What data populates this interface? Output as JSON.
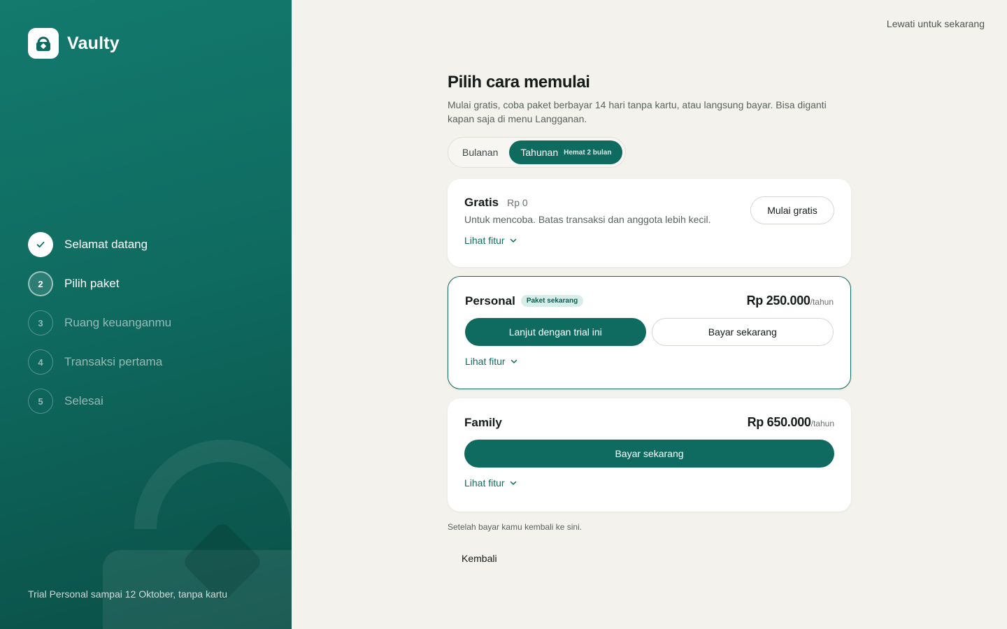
{
  "brand": {
    "name": "Vaulty",
    "icon": "lock-icon"
  },
  "steps": [
    {
      "number": "1",
      "label": "Selamat datang",
      "state": "done"
    },
    {
      "number": "2",
      "label": "Pilih paket",
      "state": "active"
    },
    {
      "number": "3",
      "label": "Ruang keuanganmu",
      "state": "todo"
    },
    {
      "number": "4",
      "label": "Transaksi pertama",
      "state": "todo"
    },
    {
      "number": "5",
      "label": "Selesai",
      "state": "todo"
    }
  ],
  "trial_note": "Trial Personal sampai 12 Oktober, tanpa kartu",
  "skip_label": "Lewati untuk sekarang",
  "heading": {
    "title": "Pilih cara memulai",
    "subtitle_line1": "Mulai gratis, coba paket berbayar 14 hari tanpa kartu, atau langsung bayar. Bisa diganti",
    "subtitle_line2": "kapan saja di menu Langganan."
  },
  "billing_toggle": {
    "monthly": "Bulanan",
    "yearly": "Tahunan",
    "yearly_tag": "Hemat 2 bulan",
    "selected": "yearly"
  },
  "plans": {
    "free": {
      "name": "Gratis",
      "price": "Rp 0",
      "description": "Untuk mencoba. Batas transaksi dan anggota lebih kecil.",
      "cta": "Mulai gratis",
      "features_label": "Lihat fitur"
    },
    "personal": {
      "name": "Personal",
      "badge": "Paket sekarang",
      "price": "Rp 250.000",
      "period": "/tahun",
      "cta_primary": "Lanjut dengan trial ini",
      "cta_secondary": "Bayar sekarang",
      "features_label": "Lihat fitur"
    },
    "family": {
      "name": "Family",
      "price": "Rp 650.000",
      "period": "/tahun",
      "cta": "Bayar sekarang",
      "features_label": "Lihat fitur"
    }
  },
  "footnote": "Setelah bayar kamu kembali ke sini.",
  "back_label": "Kembali",
  "colors": {
    "primary": "#0f6b60",
    "background": "#f3f2ed",
    "card": "#ffffff"
  }
}
